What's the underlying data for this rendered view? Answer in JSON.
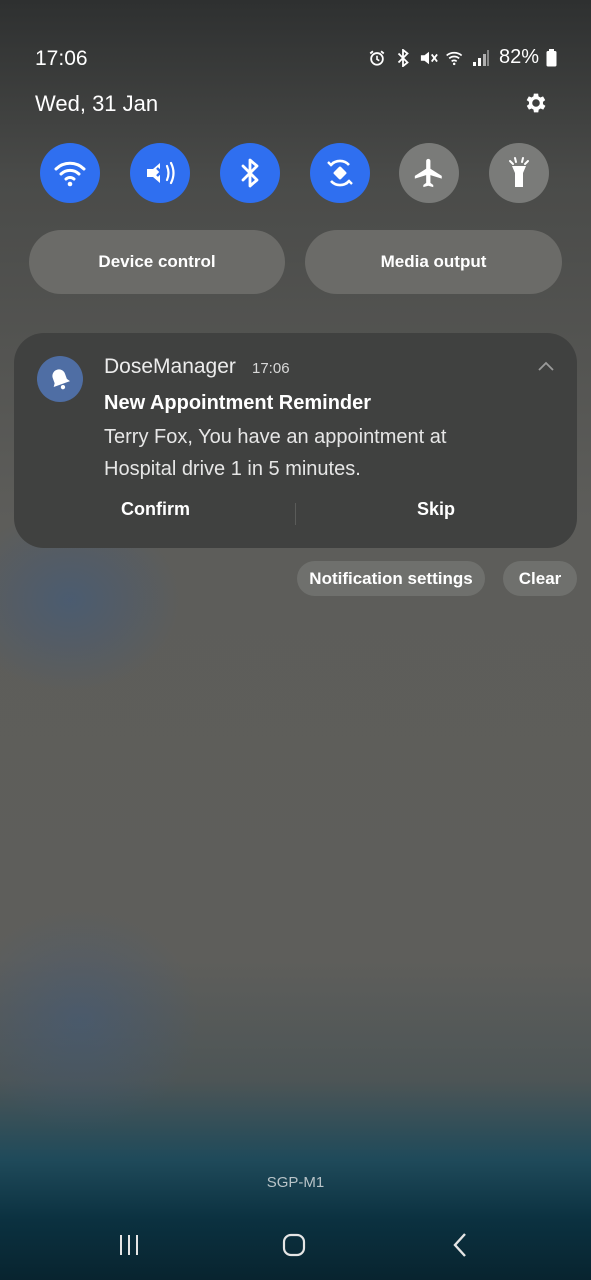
{
  "status_bar": {
    "time": "17:06",
    "battery_percent": "82%",
    "icons": [
      "alarm-icon",
      "bluetooth-icon",
      "mute-icon",
      "wifi-icon",
      "signal-icon",
      "battery-icon"
    ]
  },
  "header": {
    "date": "Wed, 31 Jan",
    "settings_icon": "gear-icon"
  },
  "quick_settings": [
    {
      "name": "wifi",
      "icon": "wifi-icon",
      "state": "on"
    },
    {
      "name": "mute",
      "icon": "mute-icon",
      "state": "on"
    },
    {
      "name": "bluetooth",
      "icon": "bluetooth-icon",
      "state": "on"
    },
    {
      "name": "auto-rotate",
      "icon": "rotate-icon",
      "state": "on"
    },
    {
      "name": "airplane-mode",
      "icon": "airplane-icon",
      "state": "off"
    },
    {
      "name": "flashlight",
      "icon": "flashlight-icon",
      "state": "off"
    }
  ],
  "buttons": {
    "device_control": "Device control",
    "media_output": "Media output"
  },
  "notification": {
    "app_name": "DoseManager",
    "time": "17:06",
    "title": "New Appointment Reminder",
    "body": "Terry  Fox, You have an appointment at Hospital drive 1 in 5 minutes.",
    "actions": {
      "confirm": "Confirm",
      "skip": "Skip"
    }
  },
  "notification_controls": {
    "settings": "Notification settings",
    "clear": "Clear"
  },
  "carrier": "SGP-M1",
  "colors": {
    "accent_on": "#2f6ff0",
    "tile_off": "#7a7b79",
    "notification_bg": "#404140",
    "app_icon_bg": "#4f6ea4"
  }
}
